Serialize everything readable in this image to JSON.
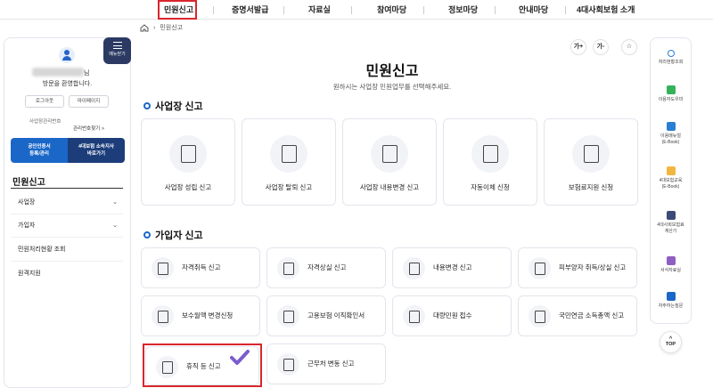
{
  "topnav": [
    "민원신고",
    "증명서발급",
    "자료실",
    "참여마당",
    "정보마당",
    "안내마당",
    "4대사회보험 소개"
  ],
  "breadcrumb": {
    "current": "민원신고"
  },
  "left": {
    "menu_label": "메뉴닫기",
    "welcome_suffix": "님",
    "welcome_line2": "방문을 환영합니다.",
    "login_btn": "로그아웃",
    "mypage_btn": "마이페이지",
    "id_label": "사업장관리번호",
    "find_label": "관리번호찾기 >",
    "cert1": "공인인증서\n등록/관리",
    "cert2": "4대보험 소속지사\n바로가기",
    "nav_title": "민원신고",
    "nav_items": [
      "사업장",
      "가입자",
      "민원처리현황 조회",
      "원격지원"
    ]
  },
  "main": {
    "title": "민원신고",
    "subtitle": "원하시는 사업장 민원업무를 선택해주세요.",
    "tools": [
      "가+",
      "가-",
      "☆"
    ],
    "section1": "사업장 신고",
    "biz_cards": [
      "사업장 성립 신고",
      "사업장 탈퇴 신고",
      "사업장 내용변경 신고",
      "자동이체 신청",
      "보험료지원 신청"
    ],
    "section2": "가입자 신고",
    "member_cards": [
      "자격취득 신고",
      "자격상실 신고",
      "내용변경 신고",
      "피부양자 취득/상실 신고",
      "보수월액 변경신청",
      "고용보험 이직확인서",
      "대량민원 접수",
      "국민연금 소득총액 신고",
      "휴직 등 신고",
      "근무처 변동 신고"
    ]
  },
  "right": {
    "items": [
      "처리현황조회",
      "이용자도우미",
      "이용매뉴얼\n(E-Book)",
      "4대보험교육\n(E-Book)",
      "4대사회보험료\n계산기",
      "서식자료실",
      "자주하는질문"
    ],
    "colors": [
      "#2a7fd4",
      "#35b25a",
      "#2a7fd4",
      "#f2b640",
      "#3c4a7a",
      "#8e5fc2",
      "#1a67c8"
    ],
    "top": "TOP"
  },
  "colors": {
    "accent": "#1a67c8",
    "highlight": "#d9262c",
    "check": "#7b5ccf"
  }
}
